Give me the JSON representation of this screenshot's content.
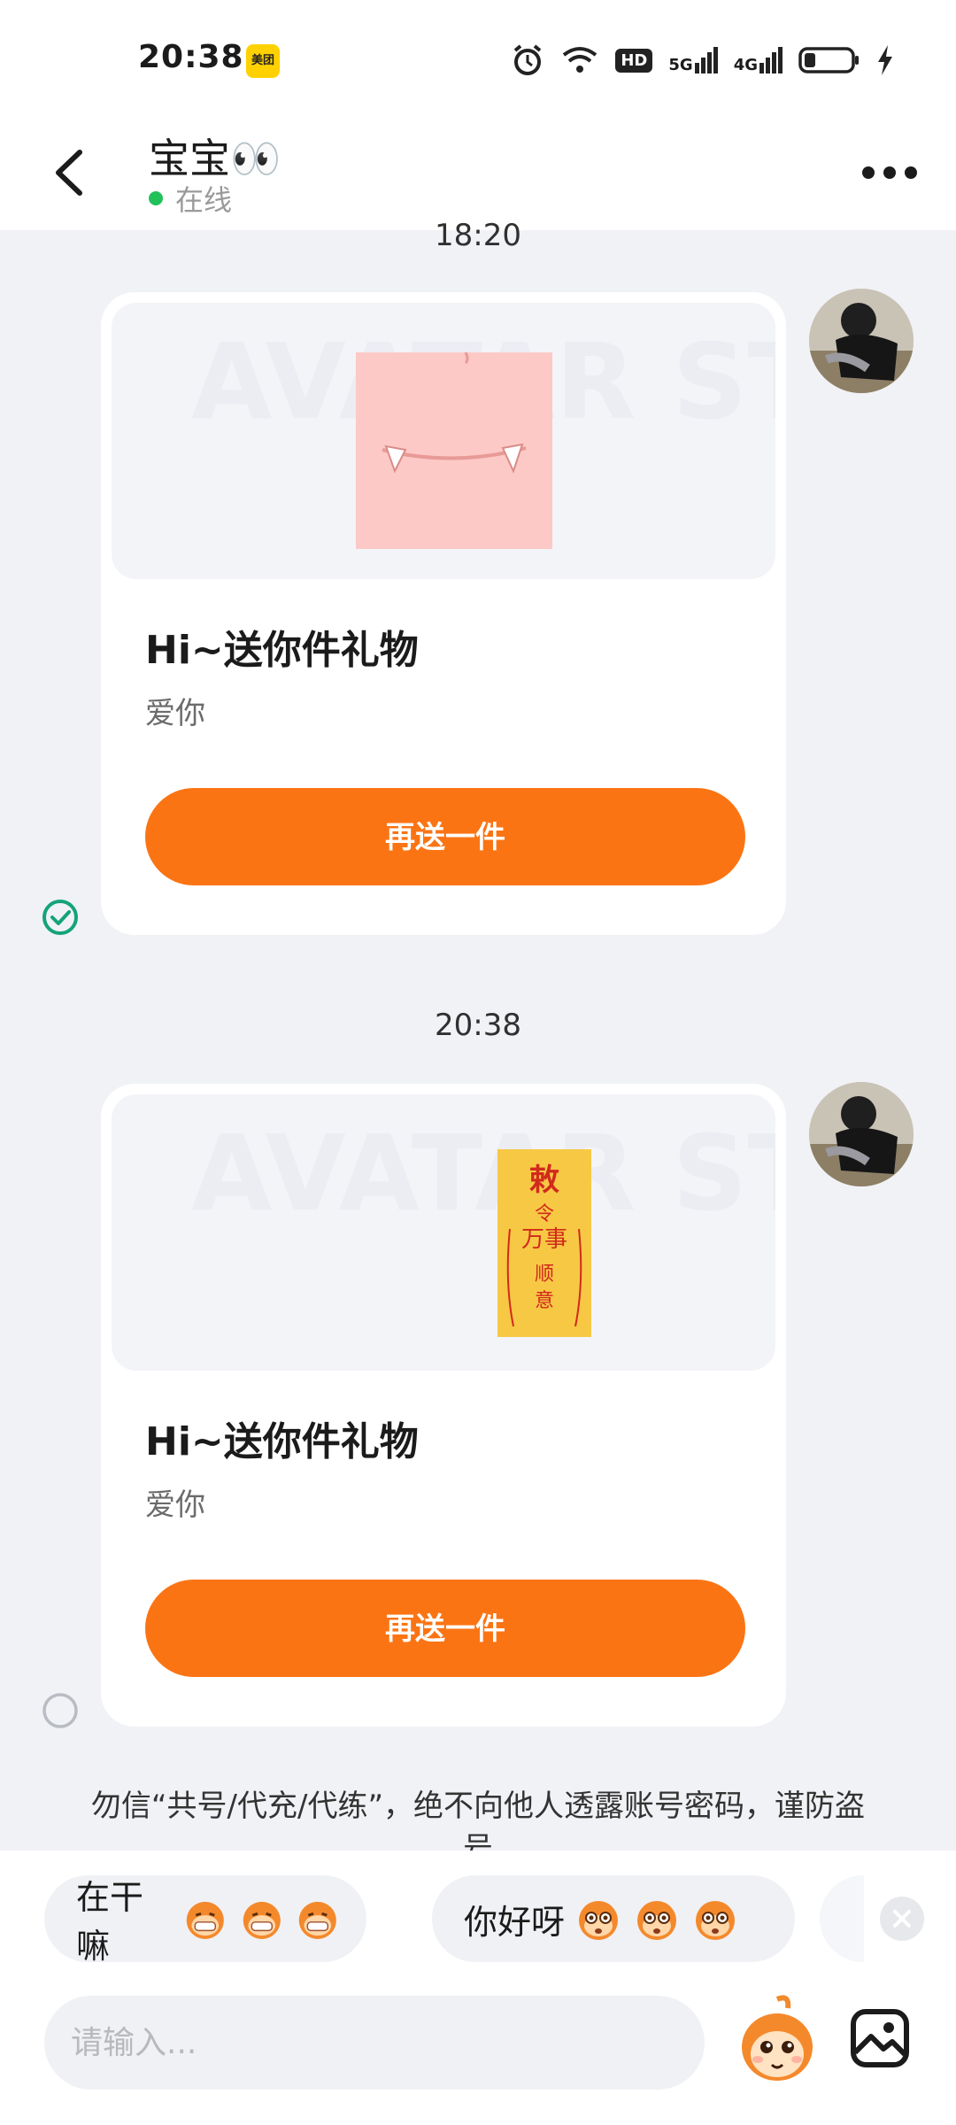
{
  "status_bar": {
    "time": "20:38",
    "app_badge": "美团",
    "hd_label": "HD",
    "net1": "5G",
    "net2": "4G",
    "icons": [
      "alarm-icon",
      "wifi-icon",
      "signal-icon",
      "battery-icon",
      "charging-icon"
    ]
  },
  "header": {
    "contact_name": "宝宝👀",
    "presence": "在线",
    "back_icon": "chevron-left-icon",
    "more_icon": "more-dots-icon"
  },
  "messages": [
    {
      "timestamp": "18:20",
      "title": "Hi~送你件礼物",
      "text": "爱你",
      "button": "再送一件",
      "status": "read"
    },
    {
      "timestamp": "20:38",
      "title": "Hi~送你件礼物",
      "text": "爱你",
      "button": "再送一件",
      "status": "sending"
    }
  ],
  "watermark": "AVATAR STORE",
  "charm_text": "敕令万事顺意",
  "warning": "勿信“共号/代充/代练”，绝不向他人透露账号密码，谨防盗号",
  "suggestions": [
    {
      "text": "在干嘛"
    },
    {
      "text": "你好呀"
    }
  ],
  "input": {
    "placeholder": "请输入..."
  },
  "colors": {
    "accent": "#fb7414",
    "online": "#21c15a",
    "read_check": "#14a37a",
    "background": "#f1f2f6"
  }
}
